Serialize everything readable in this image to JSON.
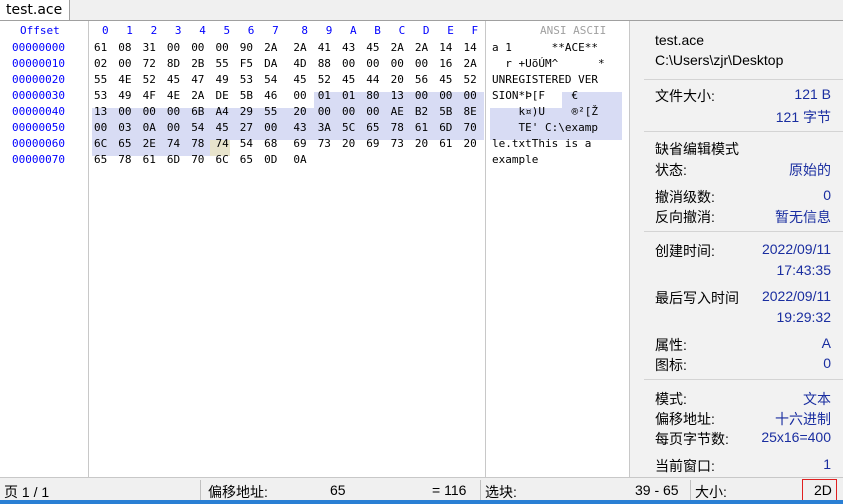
{
  "tab": {
    "title": "test.ace"
  },
  "header": {
    "offset_label": "Offset",
    "cols": [
      "0",
      "1",
      "2",
      "3",
      "4",
      "5",
      "6",
      "7",
      "8",
      "9",
      "A",
      "B",
      "C",
      "D",
      "E",
      "F"
    ],
    "ansi_label": "ANSI ASCII"
  },
  "rows": [
    {
      "offset": "00000000",
      "bytes": [
        "61",
        "08",
        "31",
        "00",
        "00",
        "00",
        "90",
        "2A",
        "2A",
        "41",
        "43",
        "45",
        "2A",
        "2A",
        "14",
        "14"
      ],
      "ascii": "a 1      **ACE**"
    },
    {
      "offset": "00000010",
      "bytes": [
        "02",
        "00",
        "72",
        "8D",
        "2B",
        "55",
        "F5",
        "DA",
        "4D",
        "88",
        "00",
        "00",
        "00",
        "00",
        "16",
        "2A"
      ],
      "ascii": "  r +UõÚM^      *"
    },
    {
      "offset": "00000020",
      "bytes": [
        "55",
        "4E",
        "52",
        "45",
        "47",
        "49",
        "53",
        "54",
        "45",
        "52",
        "45",
        "44",
        "20",
        "56",
        "45",
        "52"
      ],
      "ascii": "UNREGISTERED VER"
    },
    {
      "offset": "00000030",
      "bytes": [
        "53",
        "49",
        "4F",
        "4E",
        "2A",
        "DE",
        "5B",
        "46",
        "00",
        "01",
        "01",
        "80",
        "13",
        "00",
        "00",
        "00"
      ],
      "ascii": "SION*Þ[F    €"
    },
    {
      "offset": "00000040",
      "bytes": [
        "13",
        "00",
        "00",
        "00",
        "6B",
        "A4",
        "29",
        "55",
        "20",
        "00",
        "00",
        "00",
        "AE",
        "B2",
        "5B",
        "8E"
      ],
      "ascii": "    k¤)U    ®²[Ž"
    },
    {
      "offset": "00000050",
      "bytes": [
        "00",
        "03",
        "0A",
        "00",
        "54",
        "45",
        "27",
        "00",
        "43",
        "3A",
        "5C",
        "65",
        "78",
        "61",
        "6D",
        "70"
      ],
      "ascii": "    TE' C:\\examp"
    },
    {
      "offset": "00000060",
      "bytes": [
        "6C",
        "65",
        "2E",
        "74",
        "78",
        "74",
        "54",
        "68",
        "69",
        "73",
        "20",
        "69",
        "73",
        "20",
        "61",
        "20"
      ],
      "ascii": "le.txtThis is a "
    },
    {
      "offset": "00000070",
      "bytes": [
        "65",
        "78",
        "61",
        "6D",
        "70",
        "6C",
        "65",
        "0D",
        "0A"
      ],
      "ascii": "example"
    }
  ],
  "panel": {
    "filename": "test.ace",
    "path": "C:\\Users\\zjr\\Desktop",
    "size_label": "文件大小:",
    "size_b": "121 B",
    "size_bytes": "121 字节",
    "mode_title": "缺省编辑模式",
    "state_label": "状态:",
    "state_value": "原始的",
    "undo_label": "撤消级数:",
    "undo_value": "0",
    "redo_label": "反向撤消:",
    "redo_value": "暂无信息",
    "created_label": "创建时间:",
    "created_date": "2022/09/11",
    "created_time": "17:43:35",
    "modified_label": "最后写入时间",
    "modified_date": "2022/09/11",
    "modified_time": "19:29:32",
    "attr_label": "属性:",
    "attr_value": "A",
    "icon_label": "图标:",
    "icon_value": "0",
    "view_label": "模式:",
    "view_value": "文本",
    "offset_label": "偏移地址:",
    "offset_value": "十六进制",
    "bpp_label": "每页字节数:",
    "bpp_value": "25x16=400",
    "window_label": "当前窗口:",
    "window_value": "1"
  },
  "status": {
    "page": "页 1 / 1",
    "offset_label": "偏移地址:",
    "offset_value": "65",
    "eq_value": "= 116",
    "selection_label": "选块:",
    "selection_value": "39 - 65",
    "size_label": "大小:",
    "size_value": "2D"
  }
}
